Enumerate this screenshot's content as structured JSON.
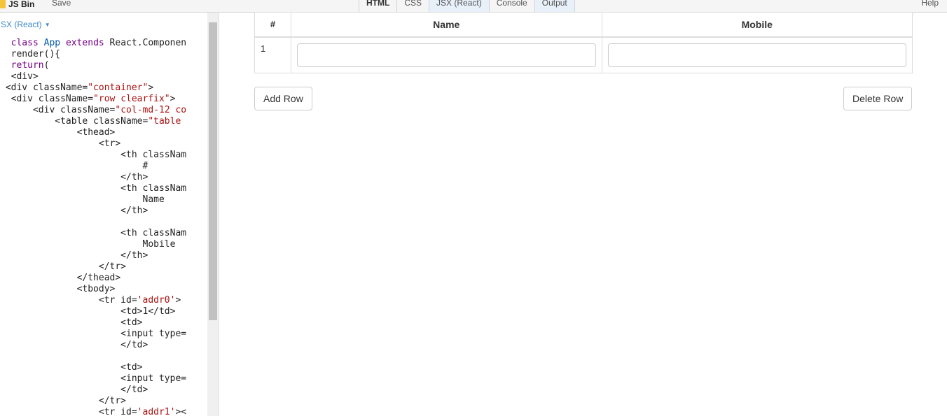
{
  "app": {
    "name": "JS Bin",
    "save_label": "Save",
    "help_label": "Help",
    "tabs": [
      {
        "label": "HTML"
      },
      {
        "label": "CSS"
      },
      {
        "label": "JSX (React)"
      },
      {
        "label": "Console"
      },
      {
        "label": "Output"
      }
    ]
  },
  "editor": {
    "panel_label": "SX (React)",
    "lines": [
      "  class App extends React.Componen",
      "  render(){",
      "  return(",
      "  <div>",
      " <div className=\"container\">",
      "  <div className=\"row clearfix\">",
      "      <div className=\"col-md-12 co",
      "          <table className=\"table",
      "              <thead>",
      "                  <tr>",
      "                      <th classNam",
      "                          #",
      "                      </th>",
      "                      <th classNam",
      "                          Name",
      "                      </th>",
      "",
      "                      <th classNam",
      "                          Mobile",
      "                      </th>",
      "                  </tr>",
      "              </thead>",
      "              <tbody>",
      "                  <tr id='addr0'>",
      "                      <td>1</td>",
      "                      <td>",
      "                      <input type=",
      "                      </td>",
      "",
      "                      <td>",
      "                      <input type=",
      "                      </td>",
      "                  </tr>",
      "                  <tr id='addr1'><"
    ]
  },
  "output": {
    "table": {
      "headers": [
        "#",
        "Name",
        "Mobile"
      ],
      "rows": [
        {
          "index": "1",
          "name": "",
          "mobile": ""
        }
      ]
    },
    "add_row_label": "Add Row",
    "delete_row_label": "Delete Row"
  },
  "colors": {
    "keyword": "#770088",
    "variable": "#0055aa",
    "string": "#aa1111",
    "panel_label": "#3d88c7"
  }
}
